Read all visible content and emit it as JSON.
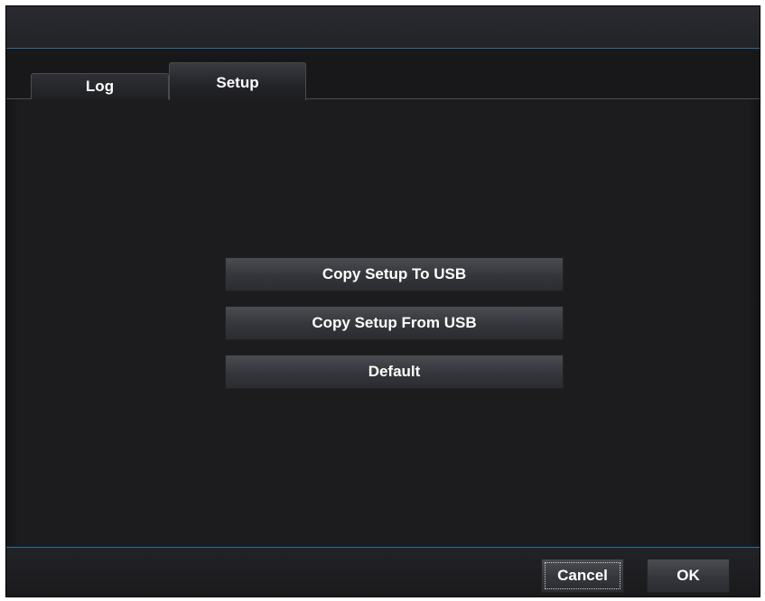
{
  "dialog": {
    "tabs": [
      {
        "label": "Log",
        "active": false
      },
      {
        "label": "Setup",
        "active": true
      }
    ],
    "setup_actions": [
      {
        "label": "Copy Setup To USB"
      },
      {
        "label": "Copy Setup From USB"
      },
      {
        "label": "Default"
      }
    ],
    "footer": {
      "cancel_label": "Cancel",
      "ok_label": "OK",
      "focused": "Cancel"
    }
  },
  "colors": {
    "background": "#1b1b1e",
    "accent_line": "#2c6e99",
    "text": "#ffffff"
  }
}
